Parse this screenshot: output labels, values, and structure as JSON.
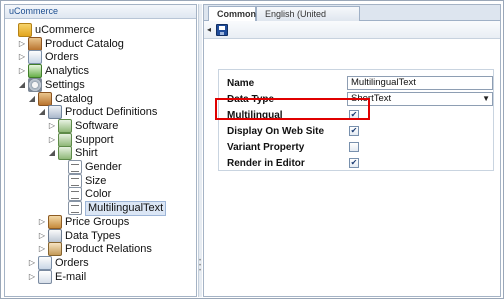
{
  "tree": {
    "header": "uCommerce",
    "nodes": [
      {
        "label": "uCommerce",
        "icon": "folder-icon",
        "expander": "",
        "level": 0
      },
      {
        "label": "Product Catalog",
        "icon": "catalog-icon",
        "expander": "▷",
        "level": 1
      },
      {
        "label": "Orders",
        "icon": "orders-icon",
        "expander": "▷",
        "level": 1
      },
      {
        "label": "Analytics",
        "icon": "analytics-icon",
        "expander": "▷",
        "level": 1
      },
      {
        "label": "Settings",
        "icon": "settings-icon",
        "expander": "◢",
        "level": 1
      },
      {
        "label": "Catalog",
        "icon": "catalog-icon",
        "expander": "◢",
        "level": 2
      },
      {
        "label": "Product Definitions",
        "icon": "definitions-icon",
        "expander": "◢",
        "level": 3
      },
      {
        "label": "Software",
        "icon": "definition-icon",
        "expander": "▷",
        "level": 4
      },
      {
        "label": "Support",
        "icon": "definition-icon",
        "expander": "▷",
        "level": 4
      },
      {
        "label": "Shirt",
        "icon": "definition-icon",
        "expander": "◢",
        "level": 4
      },
      {
        "label": "Gender",
        "icon": "field-icon",
        "expander": "",
        "level": 5
      },
      {
        "label": "Size",
        "icon": "field-icon",
        "expander": "",
        "level": 5
      },
      {
        "label": "Color",
        "icon": "field-icon",
        "expander": "",
        "level": 5
      },
      {
        "label": "MultilingualText",
        "icon": "field-icon",
        "expander": "",
        "level": 5,
        "selected": true
      },
      {
        "label": "Price Groups",
        "icon": "price-groups-icon",
        "expander": "▷",
        "level": 3
      },
      {
        "label": "Data Types",
        "icon": "data-types-icon",
        "expander": "▷",
        "level": 3
      },
      {
        "label": "Product Relations",
        "icon": "product-relations-icon",
        "expander": "▷",
        "level": 3
      },
      {
        "label": "Orders",
        "icon": "orders-icon",
        "expander": "▷",
        "level": 2
      },
      {
        "label": "E-mail",
        "icon": "email-icon",
        "expander": "▷",
        "level": 2
      }
    ]
  },
  "tabs": [
    {
      "label": "Common",
      "active": true
    },
    {
      "label": "English (United States)",
      "active": false
    }
  ],
  "toolbar": {
    "back_glyph": "◂",
    "save_icon": "save-icon"
  },
  "form": {
    "name_label": "Name",
    "name_value": "MultilingualText",
    "data_type_label": "Data Type",
    "data_type_value": "ShortText",
    "select_glyph": "▼",
    "multilingual_label": "Multilingual",
    "multilingual_checked": true,
    "display_on_web_site_label": "Display On Web Site",
    "display_on_web_site_checked": true,
    "variant_property_label": "Variant Property",
    "variant_property_checked": false,
    "render_in_editor_label": "Render in Editor",
    "render_in_editor_checked": true,
    "check_glyph": "✔"
  },
  "colors": {
    "highlight": "#e00000",
    "selection": "#dbe6f5",
    "accent": "#1d4f91"
  }
}
